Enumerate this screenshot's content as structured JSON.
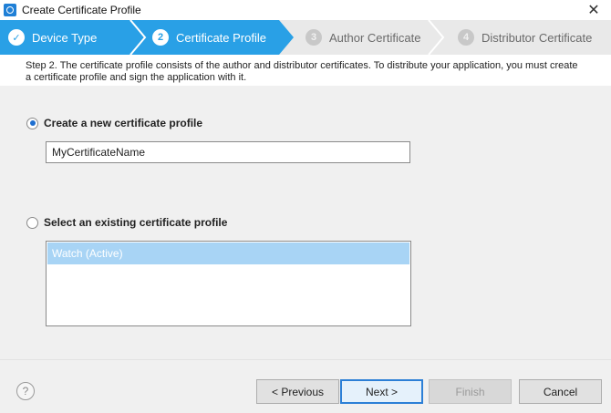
{
  "window": {
    "title": "Create Certificate Profile",
    "close_glyph": "✕"
  },
  "steps": [
    {
      "number": "1",
      "label": "Device Type",
      "state": "done"
    },
    {
      "number": "2",
      "label": "Certificate Profile",
      "state": "active"
    },
    {
      "number": "3",
      "label": "Author Certificate",
      "state": "pending"
    },
    {
      "number": "4",
      "label": "Distributor Certificate",
      "state": "pending"
    }
  ],
  "description": "Step 2. The certificate profile consists of the author and distributor certificates. To distribute your application, you must create a certificate profile and sign the application with it.",
  "options": {
    "new_profile": {
      "label": "Create a new certificate profile",
      "selected": true,
      "name_value": "MyCertificateName"
    },
    "existing_profile": {
      "label": "Select an existing certificate profile",
      "selected": false,
      "items": [
        "Watch (Active)"
      ]
    }
  },
  "buttons": {
    "help": "?",
    "previous": "< Previous",
    "next": "Next >",
    "finish": "Finish",
    "cancel": "Cancel"
  },
  "colors": {
    "step_active": "#29a0e6",
    "step_pending": "#e9e9e9",
    "list_selection": "#a8d4f5"
  }
}
